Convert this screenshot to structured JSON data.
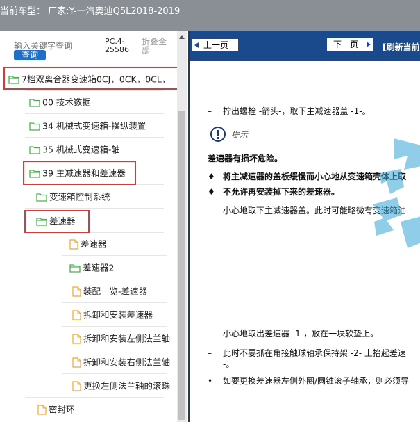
{
  "header": {
    "car_type_label": "当前车型：",
    "maker": "厂家:Y-一汽奥迪Q5L2018-2019"
  },
  "sidebar": {
    "search_placeholder": "输入关键字查询",
    "search_button": "查询",
    "pc_label": "PC.4-25586",
    "collapse_all": "折叠全部",
    "items": [
      {
        "label": "7档双离合器变速箱0CJ，0CK，0CL，"
      },
      {
        "label": "00 技术数据"
      },
      {
        "label": "34 机械式变速箱-操纵装置"
      },
      {
        "label": "35 机械式变速箱-轴"
      },
      {
        "label": "39 主减速器和差速器"
      },
      {
        "label": "变速箱控制系统"
      },
      {
        "label": "差速器"
      },
      {
        "label": "差速器"
      },
      {
        "label": "差速器2"
      },
      {
        "label": "装配一览-差速器"
      },
      {
        "label": "拆卸和安装差速器"
      },
      {
        "label": "拆卸和安装左侧法兰轴"
      },
      {
        "label": "拆卸和安装右侧法兰轴"
      },
      {
        "label": "更换左侧法兰轴的滚珠"
      },
      {
        "label": "密封环"
      }
    ]
  },
  "nav": {
    "prev": "上一页",
    "next": "下一页",
    "refresh": "[刷新当前"
  },
  "document": {
    "step1": "拧出螺栓 -箭头-，取下主减速器盖 -1-。",
    "note_label": "提示",
    "warning_title": "差速器有损坏危险。",
    "bullet1": "将主减速器的盖板缓慢而小心地从变速箱壳体上取",
    "bullet2": "不允许再安装掉下来的差速器。",
    "step2": "小心地取下主减速器盖。此时可能略微有变速箱油",
    "step3": "小心地取出差速器 -1-，放在一块软垫上。",
    "step4": "此时不要抓在角接触球轴承保持架 -2- 上抬起差速",
    "step4_cont": "-。",
    "bullet3": "如要更换差速器左侧外圈/圆锥滚子轴承，则必须导",
    "dash": "–",
    "diamond": "♦",
    "dot": "•"
  },
  "colors": {
    "titlebar": "#8a8f96",
    "nav": "#1b4a8c",
    "highlight": "#d83a3a",
    "folder": "#4caf50",
    "file": "#f5a623",
    "search_button": "#1e6fc8"
  }
}
